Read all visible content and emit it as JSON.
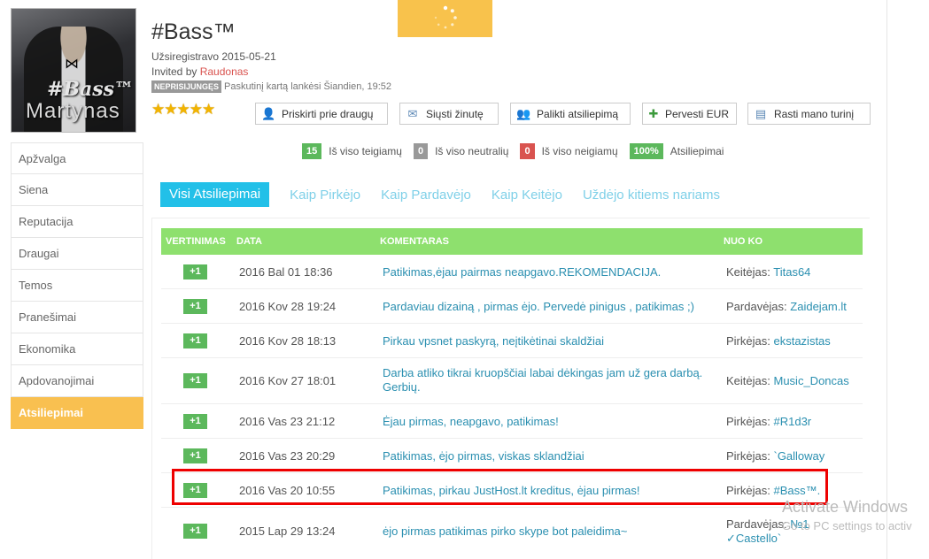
{
  "profile": {
    "name": "#Bass™",
    "registered": "Užsiregistravo 2015-05-21",
    "invited_prefix": "Invited by ",
    "invited_by": "Raudonas",
    "status_badge": "NEPRISIJUNGĘS",
    "last_visit": "Paskutinį kartą lankėsi Šiandien, 19:52",
    "rating_stars": "★★★★★",
    "rating_value": 5,
    "avatar_text_top": "#Bass™",
    "avatar_text_bottom": "Martynas"
  },
  "actions": [
    {
      "label": "Priskirti prie draugų",
      "icon": "add-friend-icon"
    },
    {
      "label": "Siųsti žinutę",
      "icon": "envelope-icon"
    },
    {
      "label": "Palikti atsiliepimą",
      "icon": "feedback-icon"
    },
    {
      "label": "Pervesti EUR",
      "icon": "money-icon"
    },
    {
      "label": "Rasti mano turinį",
      "icon": "document-icon"
    }
  ],
  "counters": [
    {
      "value": "15",
      "label": "Iš viso teigiamų",
      "color": "#5cb85c"
    },
    {
      "value": "0",
      "label": "Iš viso neutralių",
      "color": "#999999"
    },
    {
      "value": "0",
      "label": "Iš viso neigiamų",
      "color": "#d9534f"
    },
    {
      "value": "100%",
      "label": "Atsiliepimai",
      "color": "#5cb85c"
    }
  ],
  "sidebar": {
    "items": [
      {
        "label": "Apžvalga"
      },
      {
        "label": "Siena"
      },
      {
        "label": "Reputacija"
      },
      {
        "label": "Draugai"
      },
      {
        "label": "Temos"
      },
      {
        "label": "Pranešimai"
      },
      {
        "label": "Ekonomika"
      },
      {
        "label": "Apdovanojimai"
      },
      {
        "label": "Atsiliepimai",
        "active": true
      }
    ]
  },
  "tabs": [
    {
      "label": "Visi Atsiliepimai",
      "active": true
    },
    {
      "label": "Kaip Pirkėjo"
    },
    {
      "label": "Kaip Pardavėjo"
    },
    {
      "label": "Kaip Keitėjo"
    },
    {
      "label": "Uždėjo kitiems nariams"
    }
  ],
  "table": {
    "headers": {
      "vote": "VERTINIMAS",
      "date": "DATA",
      "comment": "KOMENTARAS",
      "from": "NUO KO"
    },
    "rows": [
      {
        "vote": "+1",
        "date": "2016 Bal 01 18:36",
        "comment": "Patikimas,ėjau pairmas neapgavo.REKOMENDACIJA.",
        "role": "Keitėjas:",
        "user": "Titas64"
      },
      {
        "vote": "+1",
        "date": "2016 Kov 28 19:24",
        "comment": "Pardaviau dizainą , pirmas ėjo. Pervedė pinigus , patikimas ;)",
        "role": "Pardavėjas:",
        "user": "Zaidejam.lt"
      },
      {
        "vote": "+1",
        "date": "2016 Kov 28 18:13",
        "comment": "Pirkau vpsnet paskyrą, neįtikėtinai skaldžiai",
        "role": "Pirkėjas:",
        "user": "ekstazistas"
      },
      {
        "vote": "+1",
        "date": "2016 Kov 27 18:01",
        "comment": "Darba atliko tikrai kruopščiai labai dėkingas jam už gera darbą. Gerbių.",
        "role": "Keitėjas:",
        "user": "Music_Doncas"
      },
      {
        "vote": "+1",
        "date": "2016 Vas 23 21:12",
        "comment": "Ėjau pirmas, neapgavo, patikimas!",
        "role": "Pirkėjas:",
        "user": "#R1d3r"
      },
      {
        "vote": "+1",
        "date": "2016 Vas 23 20:29",
        "comment": "Patikimas, ėjo pirmas, viskas sklandžiai",
        "role": "Pirkėjas:",
        "user": "`Galloway"
      },
      {
        "vote": "+1",
        "date": "2016 Vas 20 10:55",
        "comment": "Patikimas, pirkau JustHost.lt kreditus, ėjau pirmas!",
        "role": "Pirkėjas:",
        "user": "#Bass™."
      },
      {
        "vote": "+1",
        "date": "2015 Lap 29 13:24",
        "comment": "ėjo pirmas patikimas pirko skype bot paleidima~",
        "role": "Pardavėjas:",
        "user": "№1 ✓Castello`"
      }
    ]
  },
  "watermark": {
    "title": "Activate Windows",
    "subtitle": "Go to PC settings to activ"
  }
}
